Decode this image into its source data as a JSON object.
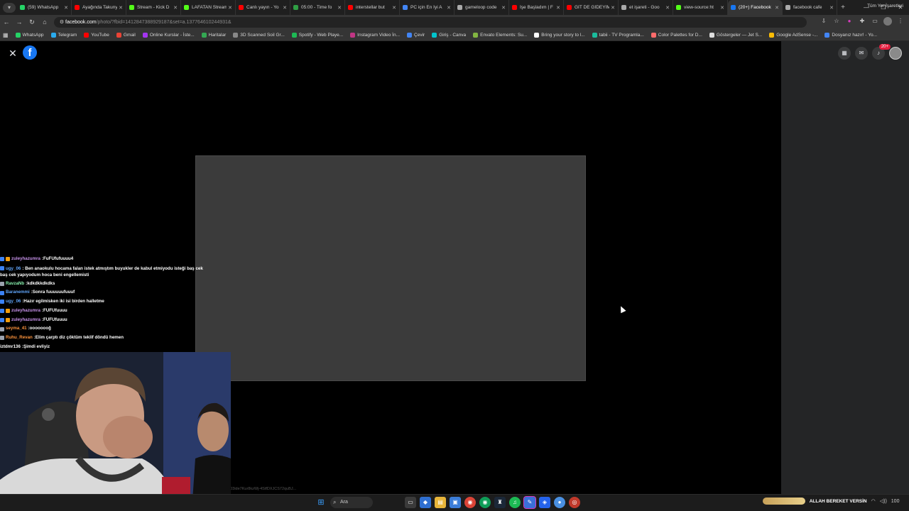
{
  "browser": {
    "tab_menu_icon": "chevron-down-icon",
    "tabs": [
      {
        "title": "(59) WhatsApp",
        "color": "#25d366"
      },
      {
        "title": "Ayağında Takunya",
        "color": "#ff0000"
      },
      {
        "title": "Stream - Kick D",
        "color": "#53fc18"
      },
      {
        "title": "LAFATAN Stream",
        "color": "#53fc18"
      },
      {
        "title": "Canlı yayın - Yo",
        "color": "#ff0000"
      },
      {
        "title": "05:00 - Time fo",
        "color": "#2f9e44"
      },
      {
        "title": "interstellar but",
        "color": "#ff0000"
      },
      {
        "title": "PC için En İyi A",
        "color": "#4285f4"
      },
      {
        "title": "gameloop code",
        "color": "#aaaaaa"
      },
      {
        "title": "İşe Başladım | F",
        "color": "#ff0000"
      },
      {
        "title": "GİT DE GİDEYİM",
        "color": "#ff0000"
      },
      {
        "title": "et işareti - Goo",
        "color": "#aaaaaa"
      },
      {
        "title": "view-source:ht",
        "color": "#53fc18"
      },
      {
        "title": "(20+) Facebook",
        "color": "#1877f2",
        "active": true
      },
      {
        "title": "facebook cafe",
        "color": "#aaaaaa"
      }
    ],
    "url_domain": "facebook.com",
    "url_path": "/photo/?fbid=1412847388929187&set=a.137764610244931&",
    "bookmarks": [
      {
        "label": "WhatsApp",
        "color": "#25d366"
      },
      {
        "label": "Telegram",
        "color": "#2aabee"
      },
      {
        "label": "YouTube",
        "color": "#ff0000"
      },
      {
        "label": "Gmail",
        "color": "#ea4335"
      },
      {
        "label": "Online Kurslar - İste...",
        "color": "#a435f0"
      },
      {
        "label": "Haritalar",
        "color": "#34a853"
      },
      {
        "label": "3D Scanned Soil Gr...",
        "color": "#888888"
      },
      {
        "label": "Spotify - Web Playe...",
        "color": "#1db954"
      },
      {
        "label": "Instagram Video İn...",
        "color": "#c13584"
      },
      {
        "label": "Çevir",
        "color": "#4285f4"
      },
      {
        "label": "Giriş - Canva",
        "color": "#00c4cc"
      },
      {
        "label": "Envato Elements: Su...",
        "color": "#82b541"
      },
      {
        "label": "Bring your story to l...",
        "color": "#ffffff"
      },
      {
        "label": "tabii - TV Programla...",
        "color": "#1abc9c"
      },
      {
        "label": "Color Palettes for D...",
        "color": "#ff6b6b"
      },
      {
        "label": "Göstergeler — Jet S...",
        "color": "#dddddd"
      },
      {
        "label": "Google AdSense -...",
        "color": "#fbbc05"
      },
      {
        "label": "Dosyanız hazır! - Yo...",
        "color": "#4285f4"
      }
    ],
    "all_bookmarks": "Tüm Yer İşaretleri"
  },
  "facebook": {
    "close_icon": "close-icon",
    "logo_letter": "f",
    "notification_count": "20+"
  },
  "chat": [
    {
      "user": "zuleyhazumra",
      "user_color": "#c792ea",
      "msg": "FuFUfufuuuu4",
      "badges": [
        "#3b82f6",
        "#f59e0b"
      ]
    },
    {
      "user": "ugy_06",
      "user_color": "#60a5fa",
      "msg": "Ben anaokulu hocama falan istek atmıştım buyukler de kabul etmiyodu isteği baş cek baş cek yapıyodum hoca beni engellemisti",
      "badges": [
        "#3b82f6"
      ],
      "wrap": true
    },
    {
      "user": "RavzaNb",
      "user_color": "#86efac",
      "msg": "kdkdkkdkdks",
      "badges": [
        "#9ca3af"
      ]
    },
    {
      "user": "Baranemmi",
      "user_color": "#60a5fa",
      "msg": "Sonra fuuuuuufuuuf",
      "badges": [
        "#3b82f6"
      ]
    },
    {
      "user": "ugy_06",
      "user_color": "#60a5fa",
      "msg": "Hazır egilmisken iki isi birden halletme",
      "badges": [
        "#3b82f6"
      ]
    },
    {
      "user": "zuleyhazumra",
      "user_color": "#c792ea",
      "msg": "FUFUfuuuu",
      "badges": [
        "#3b82f6",
        "#f59e0b"
      ]
    },
    {
      "user": "zuleyhazumra",
      "user_color": "#c792ea",
      "msg": "FUFUfuuuu",
      "badges": [
        "#3b82f6",
        "#f59e0b"
      ]
    },
    {
      "user": "seyma_41",
      "user_color": "#fb923c",
      "msg": "oooooooğ",
      "badges": [
        "#9ca3af"
      ]
    },
    {
      "user": "Ruhu_Revan",
      "user_color": "#fb923c",
      "msg": "Elim çarptı diz çöktüm teklif döndü hemen",
      "badges": [
        "#9ca3af"
      ]
    },
    {
      "user": "iztdmr136",
      "user_color": "#ffffff",
      "msg": "Şimdi evliyiz",
      "badges": []
    }
  ],
  "status_url": "O3ide7Kur8kzWj-4StfDXJCS72quBJ...",
  "taskbar": {
    "search_placeholder": "Ara",
    "ticker_text": "ALLAH BEREKET VERSİN",
    "volume": "100"
  }
}
